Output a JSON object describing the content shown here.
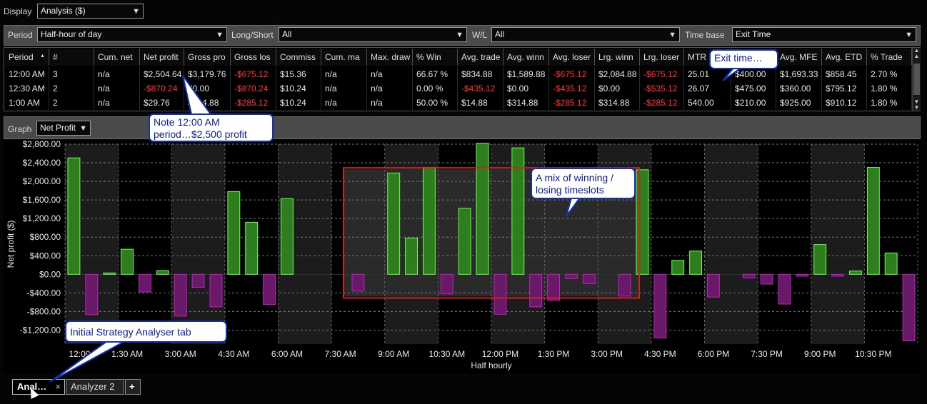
{
  "display": {
    "label": "Display",
    "value": "Analysis ($)"
  },
  "filters": {
    "period_label": "Period",
    "period_value": "Half-hour of day",
    "longshort_label": "Long/Short",
    "longshort_value": "All",
    "wl_label": "W/L",
    "wl_value": "All",
    "timebase_label": "Time base",
    "timebase_value": "Exit Time"
  },
  "table": {
    "columns": [
      "Period",
      "#",
      "Cum. net",
      "Net profit",
      "Gross pro",
      "Gross los",
      "Commiss",
      "Cum. ma",
      "Max. draw",
      "% Win",
      "Avg. trade",
      "Avg. winn",
      "Avg. loser",
      "Lrg. winn",
      "Lrg. loser",
      "MTR",
      "",
      "Avg. MFE",
      "Avg. ETD",
      "% Trade"
    ],
    "rows": [
      [
        "12:00 AM",
        "3",
        "n/a",
        "$2,504.64",
        "$3,179.76",
        "-$675.12",
        "$15.36",
        "n/a",
        "n/a",
        "66.67 %",
        "$834.88",
        "$1,589.88",
        "-$675.12",
        "$2,084.88",
        "-$675.12",
        "25.01",
        "$400.00",
        "$1,693.33",
        "$858.45",
        "2.70 %"
      ],
      [
        "12:30 AM",
        "2",
        "n/a",
        "-$870.24",
        "$0.00",
        "-$870.24",
        "$10.24",
        "n/a",
        "n/a",
        "0.00 %",
        "-$435.12",
        "$0.00",
        "-$435.12",
        "$0.00",
        "-$535.12",
        "26.07",
        "$475.00",
        "$360.00",
        "$795.12",
        "1.80 %"
      ],
      [
        "1:00 AM",
        "2",
        "n/a",
        "$29.76",
        "$314.88",
        "-$285.12",
        "$10.24",
        "n/a",
        "n/a",
        "50.00 %",
        "$14.88",
        "$314.88",
        "-$285.12",
        "$314.88",
        "-$285.12",
        "540.00",
        "$210.00",
        "$925.00",
        "$910.12",
        "1.80 %"
      ]
    ]
  },
  "graph": {
    "label": "Graph",
    "value": "Net Profit"
  },
  "callouts": {
    "exit_time": "Exit time…",
    "note_1": "Note 12:00 AM",
    "note_2": "period…$2,500 profit",
    "mix_1": "A mix of winning /",
    "mix_2": "losing timeslots",
    "initial": "Initial Strategy Analyser tab"
  },
  "tabs": {
    "tab1": "Anal…",
    "tab2": "Analyzer 2",
    "add": "+",
    "close": "×"
  },
  "chart_data": {
    "type": "bar",
    "ylabel": "Net profit ($)",
    "xlabel": "Half hourly",
    "ylim": [
      -1500,
      2800
    ],
    "yticks": [
      2800,
      2400,
      2000,
      1600,
      1200,
      800,
      400,
      0,
      -400,
      -800,
      -1200
    ],
    "ytick_labels": [
      "$2,800.00",
      "$2,400.00",
      "$2,000.00",
      "$1,600.00",
      "$1,200.00",
      "$800.00",
      "$400.00",
      "$0.00",
      "-$400.00",
      "-$800.00",
      "-$1,200.00"
    ],
    "xtick_labels": [
      "12:00",
      "1:30 AM",
      "3:00 AM",
      "4:30 AM",
      "6:00 AM",
      "7:30 AM",
      "9:00 AM",
      "10:30 AM",
      "12:00 PM",
      "1:30 PM",
      "3:00 PM",
      "4:30 PM",
      "6:00 PM",
      "7:30 PM",
      "9:00 PM",
      "10:30 PM"
    ],
    "values": [
      2504.64,
      -870.24,
      29.76,
      540,
      -380,
      80,
      -900,
      -280,
      -700,
      1780,
      1120,
      -650,
      1630,
      null,
      null,
      null,
      -360,
      null,
      2180,
      780,
      2300,
      -420,
      1420,
      2820,
      -860,
      2720,
      -700,
      -560,
      -90,
      -200,
      null,
      -470,
      2250,
      -1370,
      300,
      500,
      -490,
      null,
      -80,
      -210,
      -640,
      -40,
      640,
      -40,
      70,
      2300,
      460,
      -1430
    ],
    "highlight": {
      "from_index": 16,
      "to_index": 31
    }
  },
  "colors": {
    "positive": "#2e7d1e",
    "positive_edge": "#6aff50",
    "negative": "#681a68",
    "negative_edge": "#c020c0",
    "highlight": "#d42020"
  }
}
